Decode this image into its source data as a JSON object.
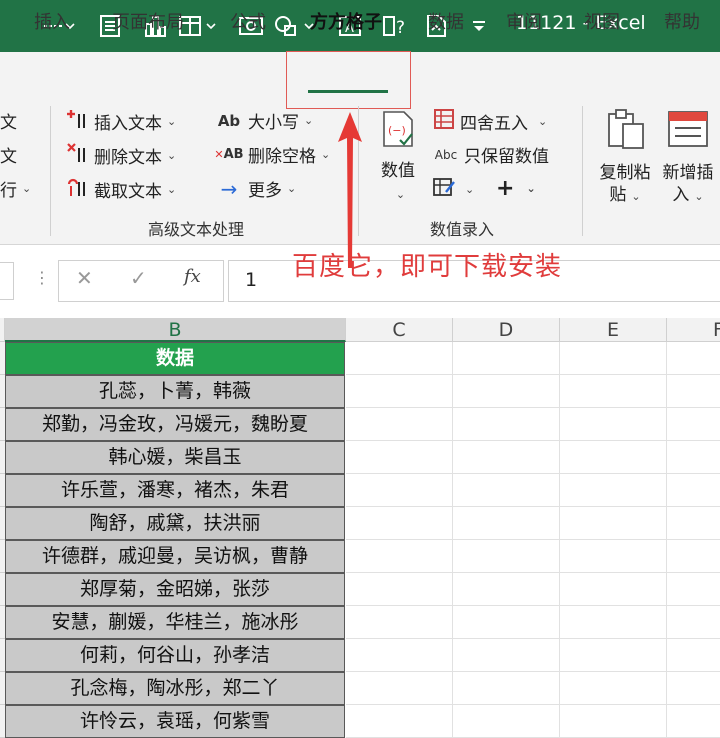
{
  "window": {
    "title": "11121  -  Excel"
  },
  "quick_access": [
    {
      "icon": "dotted-divider-icon"
    },
    {
      "icon": "form-icon"
    },
    {
      "icon": "bar-chart-icon"
    },
    {
      "icon": "table-grid-icon"
    },
    {
      "icon": "screenshot-icon"
    },
    {
      "icon": "shapes-icon"
    },
    {
      "icon": "text-box-icon"
    },
    {
      "icon": "help-icon"
    },
    {
      "icon": "document-icon"
    },
    {
      "icon": "customize-qat-icon"
    }
  ],
  "tabs": [
    {
      "label": "插入"
    },
    {
      "label": "页面布局"
    },
    {
      "label": "公式"
    },
    {
      "label": "方方格子",
      "active": true
    },
    {
      "label": "数据"
    },
    {
      "label": "审阅"
    },
    {
      "label": "视图"
    },
    {
      "label": "帮助"
    }
  ],
  "ribbon": {
    "left_fragments": [
      "文",
      "文",
      "行"
    ],
    "advanced_text": {
      "insert_text": "插入文本",
      "delete_text": "删除文本",
      "extract_text": "截取文本",
      "case": "大小写",
      "delete_spaces": "删除空格",
      "more": "更多",
      "label": "高级文本处理"
    },
    "number_entry": {
      "value": "数值",
      "round": "四舍五入",
      "keep_numbers": "只保留数值",
      "label": "数值录入"
    },
    "copy_paste": {
      "line1": "复制粘",
      "line2": "贴"
    },
    "add_insert": {
      "line1": "新增插",
      "line2": "入"
    }
  },
  "annotation": "百度它，即可下载安装",
  "formula_bar": {
    "cancel": "✕",
    "confirm": "✓",
    "fx": "fx",
    "value": "1"
  },
  "columns": [
    "B",
    "C",
    "D",
    "E",
    "F"
  ],
  "sheet": {
    "header": "数据",
    "rows": [
      "孔蕊，卜菁，韩薇",
      "郑勤，冯金玫，冯媛元，魏盼夏",
      "韩心媛，柴昌玉",
      "许乐萱，潘寒，褚杰，朱君",
      "陶舒，戚黛，扶洪丽",
      "许德群，戚迎曼，吴访枫，曹静",
      "郑厚菊，金昭娣，张莎",
      "安慧，蒯媛，华桂兰，施冰彤",
      "何莉，何谷山，孙孝洁",
      "孔念梅，陶冰彤，郑二丫",
      "许怜云，袁瑶，何紫雪"
    ]
  },
  "colors": {
    "brand": "#217346",
    "header_fill": "#23a14e",
    "cell_fill": "#c9c9c9",
    "annotation": "#e03c3c"
  }
}
